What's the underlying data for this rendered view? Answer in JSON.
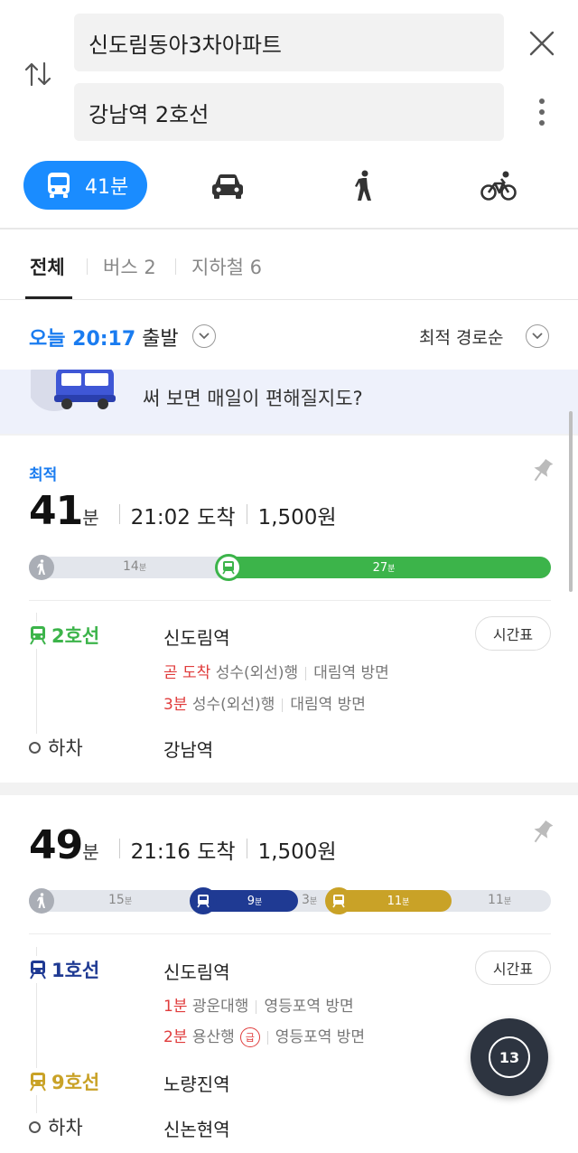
{
  "search": {
    "from": "신도림동아3차아파트",
    "to": "강남역 2호선"
  },
  "modes": {
    "bus_label": "41분"
  },
  "tabs": [
    {
      "label": "전체"
    },
    {
      "label": "버스 2"
    },
    {
      "label": "지하철 6"
    }
  ],
  "departure": {
    "time": "오늘 20:17",
    "suffix": "출발",
    "sort": "최적 경로순"
  },
  "banner": {
    "text": "써 보면 매일이 편해질지도?"
  },
  "routes": [
    {
      "badge": "최적",
      "minutes": "41",
      "minutes_unit": "분",
      "arrival": "21:02 도착",
      "fare": "1,500원",
      "bar": [
        {
          "kind": "walk",
          "num": "14",
          "unit": "분",
          "fraction": 0.37
        },
        {
          "kind": "subway",
          "line": "2호선",
          "num": "27",
          "unit": "분",
          "fraction": 0.63
        }
      ],
      "legs": [
        {
          "line": "2호선",
          "station": "신도림역",
          "timetable": "시간표",
          "arrivals": [
            {
              "eta": "곧 도착",
              "direction": "성수(외선)행",
              "towards": "대림역 방면"
            },
            {
              "eta": "3분",
              "direction": "성수(외선)행",
              "towards": "대림역 방면"
            }
          ]
        }
      ],
      "alight": {
        "label": "하차",
        "station": "강남역"
      }
    },
    {
      "minutes": "49",
      "minutes_unit": "분",
      "arrival": "21:16 도착",
      "fare": "1,500원",
      "bar": [
        {
          "kind": "walk",
          "num": "15",
          "unit": "분"
        },
        {
          "kind": "subway",
          "line": "1호선",
          "num": "9",
          "unit": "분"
        },
        {
          "kind": "transfer",
          "num": "3",
          "unit": "분"
        },
        {
          "kind": "subway",
          "line": "9호선",
          "num": "11",
          "unit": "분"
        },
        {
          "kind": "walk",
          "num": "11",
          "unit": "분"
        }
      ],
      "legs": [
        {
          "line": "1호선",
          "station": "신도림역",
          "timetable": "시간표",
          "arrivals": [
            {
              "eta": "1분",
              "direction": "광운대행",
              "towards": "영등포역 방면"
            },
            {
              "eta": "2분",
              "direction": "용산행",
              "express": "급",
              "towards": "영등포역 방면"
            }
          ]
        },
        {
          "line": "9호선",
          "station": "노량진역"
        }
      ],
      "alight": {
        "label": "하차",
        "station": "신논현역"
      }
    }
  ],
  "fab": {
    "label": "13"
  },
  "colors": {
    "accent": "#1a8cff",
    "line2": "#3cb44a",
    "line1": "#1f3a93",
    "line9": "#c9a227",
    "red": "#e03c3c"
  }
}
